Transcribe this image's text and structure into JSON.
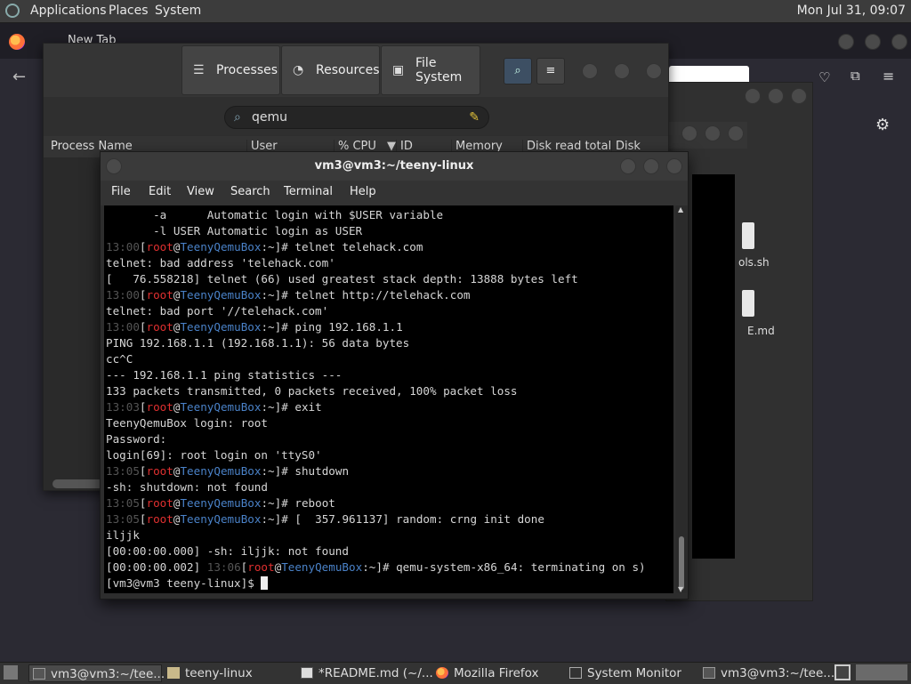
{
  "topbar": {
    "applications": "Applications",
    "places": "Places",
    "system": "System",
    "clock": "Mon Jul 31, 09:07"
  },
  "firefox": {
    "tab_title": "New Tab"
  },
  "sysmon": {
    "tabs": [
      {
        "icon": "list-icon",
        "label": "Processes"
      },
      {
        "icon": "gauge-icon",
        "label": "Resources"
      },
      {
        "icon": "disk-icon",
        "label": "File System"
      }
    ],
    "search_value": "qemu",
    "columns": [
      "Process Name",
      "User",
      "% CPU",
      "ID",
      "Memory",
      "Disk read total",
      "Disk write"
    ]
  },
  "files": {
    "labels": [
      "ols.sh",
      "E.md"
    ]
  },
  "terminal": {
    "title": "vm3@vm3:~/teeny-linux",
    "menu": [
      "File",
      "Edit",
      "View",
      "Search",
      "Terminal",
      "Help"
    ],
    "prompt_user": "root",
    "prompt_host": "TeenyQemuBox",
    "prompt_path": ":~]",
    "lines": [
      {
        "type": "text",
        "text": "       -a      Automatic login with $USER variable"
      },
      {
        "type": "text",
        "text": "       -l USER Automatic login as USER"
      },
      {
        "type": "prompt",
        "time": "13:00",
        "cmd": "# telnet telehack.com"
      },
      {
        "type": "text",
        "text": "telnet: bad address 'telehack.com'"
      },
      {
        "type": "text",
        "text": "[   76.558218] telnet (66) used greatest stack depth: 13888 bytes left"
      },
      {
        "type": "prompt",
        "time": "13:00",
        "cmd": "# telnet http://telehack.com"
      },
      {
        "type": "text",
        "text": "telnet: bad port '//telehack.com'"
      },
      {
        "type": "prompt",
        "time": "13:00",
        "cmd": "# ping 192.168.1.1"
      },
      {
        "type": "text",
        "text": "PING 192.168.1.1 (192.168.1.1): 56 data bytes"
      },
      {
        "type": "text",
        "text": "cc^C"
      },
      {
        "type": "text",
        "text": "--- 192.168.1.1 ping statistics ---"
      },
      {
        "type": "text",
        "text": "133 packets transmitted, 0 packets received, 100% packet loss"
      },
      {
        "type": "prompt",
        "time": "13:03",
        "cmd": "# exit"
      },
      {
        "type": "text",
        "text": "TeenyQemuBox login: root"
      },
      {
        "type": "text",
        "text": "Password:"
      },
      {
        "type": "text",
        "text": "login[69]: root login on 'ttyS0'"
      },
      {
        "type": "prompt",
        "time": "13:05",
        "cmd": "# shutdown"
      },
      {
        "type": "text",
        "text": "-sh: shutdown: not found"
      },
      {
        "type": "prompt",
        "time": "13:05",
        "cmd": "# reboot"
      },
      {
        "type": "prompt",
        "time": "13:05",
        "cmd": "# [  357.961137] random: crng init done"
      },
      {
        "type": "text",
        "text": "iljjk"
      },
      {
        "type": "text",
        "text": "[00:00:00.000] -sh: iljjk: not found"
      },
      {
        "type": "prompt",
        "pre": "[00:00:00.002] ",
        "time": "13:06",
        "cmd": "# qemu-system-x86_64: terminating on s)"
      },
      {
        "type": "text",
        "text": "[vm3@vm3 teeny-linux]$ ",
        "cursor": true
      }
    ]
  },
  "taskbar": {
    "items": [
      {
        "label": "vm3@vm3:~/tee...",
        "icon": "terminal-icon",
        "active": true
      },
      {
        "label": "teeny-linux",
        "icon": "folder-icon"
      },
      {
        "label": "*README.md (~/...",
        "icon": "editor-icon"
      },
      {
        "label": "Mozilla Firefox",
        "icon": "firefox-icon"
      },
      {
        "label": "System Monitor",
        "icon": "monitor-icon"
      },
      {
        "label": "vm3@vm3:~/tee...",
        "icon": "terminal-icon"
      }
    ]
  }
}
